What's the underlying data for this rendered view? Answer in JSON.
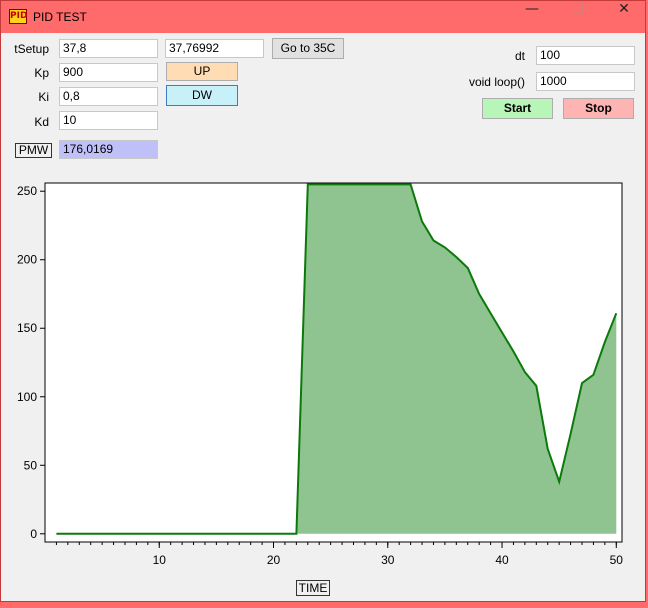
{
  "window": {
    "title": "PID TEST",
    "icon_text": "PID",
    "minimize": "—",
    "maximize": "☐",
    "close": "✕"
  },
  "controls": {
    "tsetup": {
      "label": "tSetup",
      "value": "37,8",
      "measured": "37,76992"
    },
    "kp": {
      "label": "Kp",
      "value": "900"
    },
    "ki": {
      "label": "Ki",
      "value": "0,8"
    },
    "kd": {
      "label": "Kd",
      "value": "10"
    },
    "pmw": {
      "label": "PMW",
      "value": "176,0169"
    },
    "goto_button": "Go to 35C",
    "up_button": "UP",
    "dw_button": "DW",
    "dt": {
      "label": "dt",
      "value": "100"
    },
    "loop": {
      "label": "void loop()",
      "value": "1000"
    },
    "start_button": "Start",
    "stop_button": "Stop"
  },
  "colors": {
    "title_bar": "#ff6b6b",
    "series_line": "#0a7a0a",
    "series_fill": "#8fc38f",
    "up_button": "#ffdcb4",
    "dw_button": "#c8f0f8",
    "start_button": "#b8f5b8",
    "stop_button": "#ffb4b4",
    "pmw_field": "#c0c0f8"
  },
  "chart_data": {
    "type": "area",
    "xlabel": "TIME",
    "x_ticks": [
      "10",
      "20",
      "30",
      "40",
      "50"
    ],
    "y_ticks": [
      "0",
      "50",
      "100",
      "150",
      "200",
      "250"
    ],
    "xlim": [
      0,
      50.5
    ],
    "ylim": [
      -6,
      256
    ],
    "grid": false,
    "series": [
      {
        "x": [
          1,
          2,
          3,
          4,
          5,
          6,
          7,
          8,
          9,
          10,
          11,
          12,
          13,
          14,
          15,
          16,
          17,
          18,
          19,
          20,
          21,
          22,
          23,
          24,
          25,
          26,
          27,
          28,
          29,
          30,
          31,
          32,
          33,
          34,
          35,
          36,
          37,
          38,
          39,
          40,
          41,
          42,
          43,
          44,
          45,
          46,
          47,
          48,
          49,
          50
        ],
        "y": [
          0,
          0,
          0,
          0,
          0,
          0,
          0,
          0,
          0,
          0,
          0,
          0,
          0,
          0,
          0,
          0,
          0,
          0,
          0,
          0,
          0,
          0,
          255,
          255,
          255,
          255,
          255,
          255,
          255,
          255,
          255,
          255,
          228,
          214,
          209,
          202,
          194,
          175,
          161,
          147,
          133,
          118,
          108,
          62,
          38,
          73,
          110,
          116,
          140,
          161
        ]
      }
    ]
  }
}
